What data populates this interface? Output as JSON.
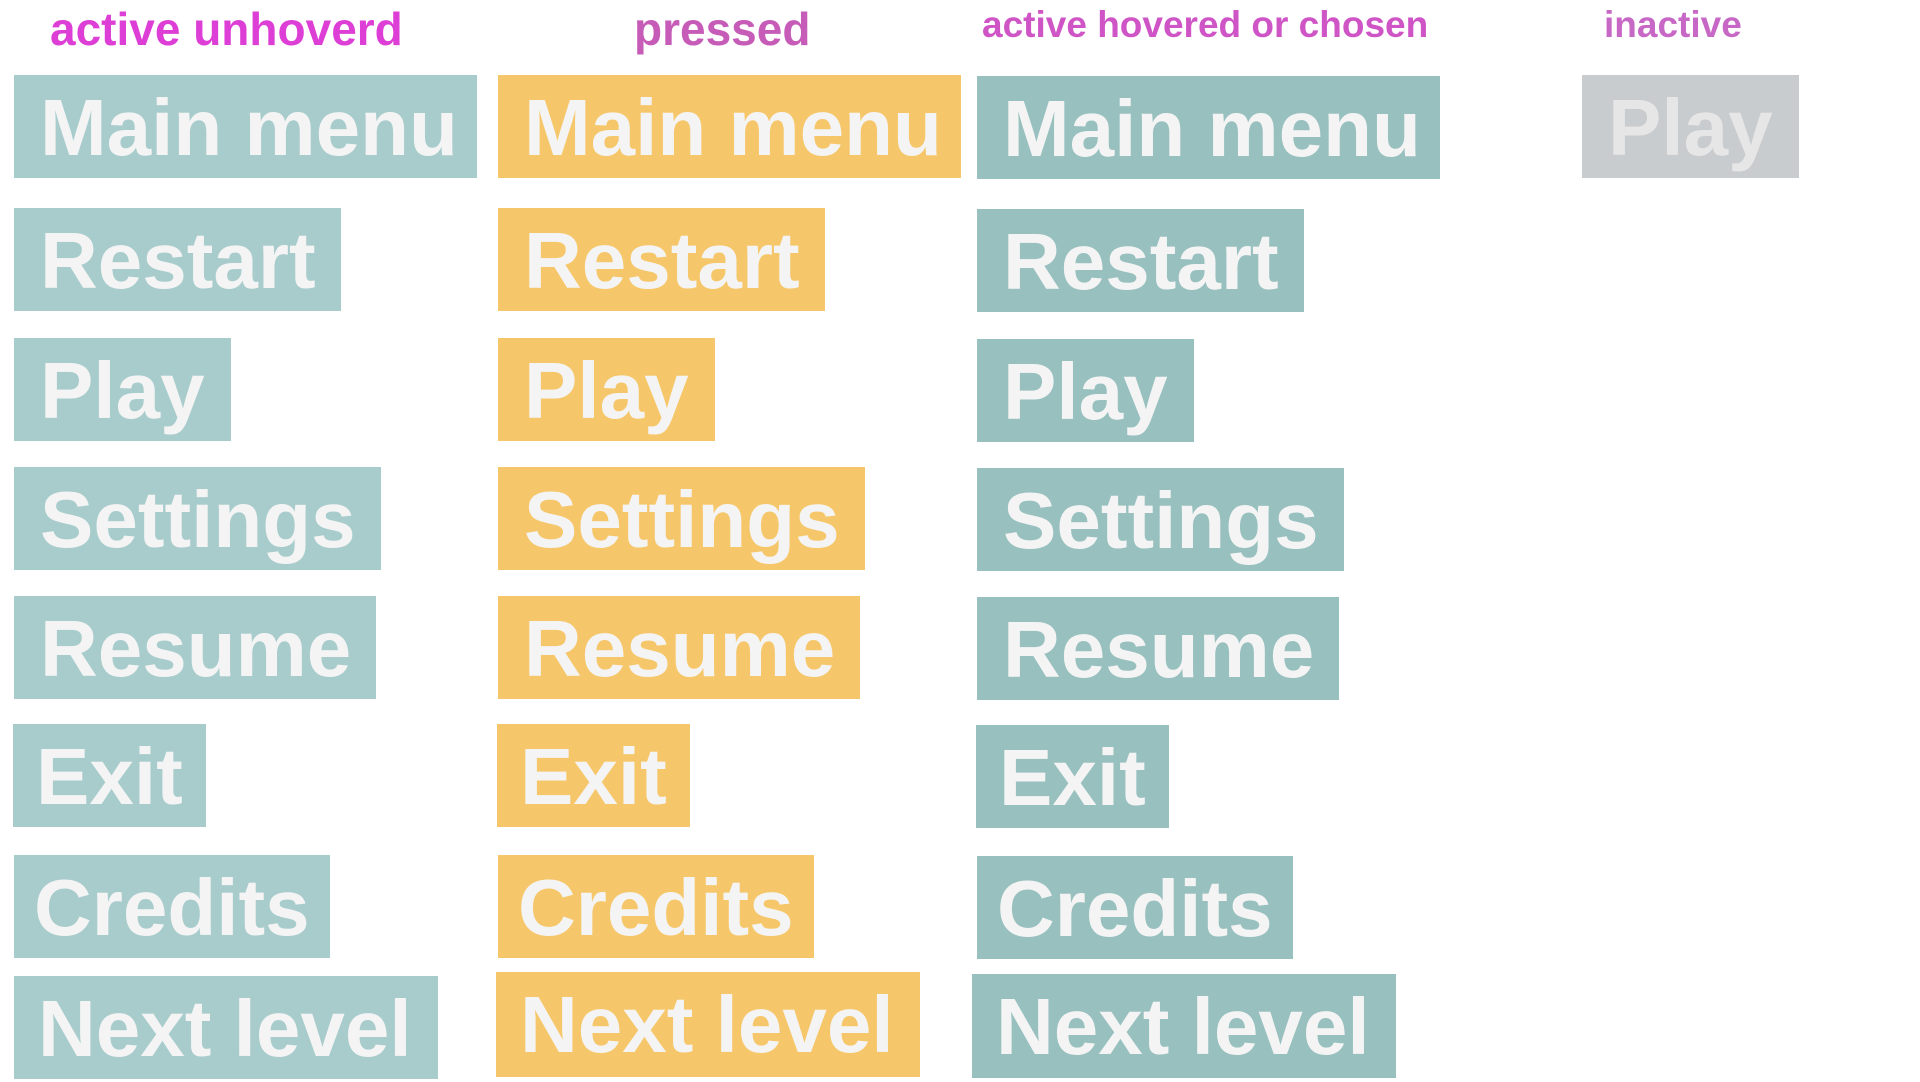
{
  "headers": {
    "unhovered": "active unhoverd",
    "pressed": "pressed",
    "hovered": "active hovered or chosen",
    "inactive": "inactive"
  },
  "colors": {
    "header_text": "#d84ad0",
    "unhovered_bg": "#a8cccc",
    "pressed_bg": "#f6c76a",
    "hovered_bg": "#97c0be",
    "inactive_bg": "#c8cccf",
    "button_text": "#f4f4f4",
    "inactive_text": "#e6e6e6"
  },
  "buttons": {
    "main_menu": "Main menu",
    "restart": "Restart",
    "play": "Play",
    "settings": "Settings",
    "resume": "Resume",
    "exit": "Exit",
    "credits": "Credits",
    "next_level": "Next level"
  },
  "inactive_button": "Play"
}
